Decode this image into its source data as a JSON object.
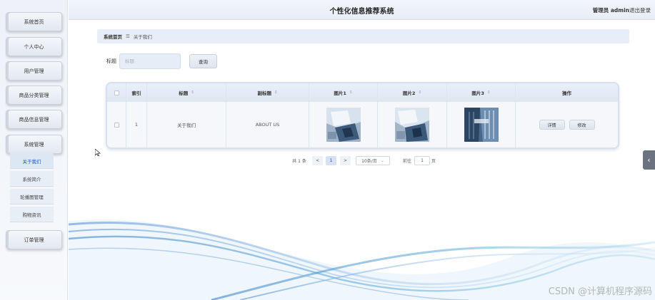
{
  "header": {
    "title": "个性化信息推荐系统",
    "user": "管理员 admin",
    "logout": "退出登录"
  },
  "sidebar": {
    "items": [
      {
        "label": "系统首页"
      },
      {
        "label": "个人中心"
      },
      {
        "label": "用户管理"
      },
      {
        "label": "商品分类管理"
      },
      {
        "label": "商品信息管理"
      },
      {
        "label": "系统管理"
      },
      {
        "label": "订单管理"
      }
    ],
    "submenu": [
      {
        "label": "关于我们"
      },
      {
        "label": "系统简介"
      },
      {
        "label": "轮播图管理"
      },
      {
        "label": "购物资讯"
      }
    ]
  },
  "breadcrumb": {
    "home": "系统首页",
    "separator": "☰",
    "current": "关于我们"
  },
  "search": {
    "label": "标题",
    "placeholder": "标题",
    "button": "查询"
  },
  "table": {
    "headers": {
      "index": "索引",
      "title": "标题",
      "subtitle": "副标题",
      "img1": "图片1",
      "img2": "图片2",
      "img3": "图片3",
      "ops": "操作"
    },
    "sort_glyph": "⇕",
    "rows": [
      {
        "index": "1",
        "title": "关于我们",
        "subtitle": "ABOUT US",
        "detail": "详情",
        "edit": "修改"
      }
    ]
  },
  "pagination": {
    "total": "共 1 条",
    "prev": "<",
    "page": "1",
    "next": ">",
    "page_size": "10条/页",
    "goto": "前往",
    "goto_value": "1",
    "page_unit": "页"
  },
  "side_toggle": "‹",
  "watermark": "CSDN @计算机程序源码",
  "colors": {
    "accent": "#1a56b0",
    "header_bg": "#eef2f8",
    "table_border": "#d6e0ee"
  },
  "icons": {
    "sort": "sort-icon",
    "checkbox": "checkbox-icon",
    "collapse": "chevron-left-icon"
  }
}
